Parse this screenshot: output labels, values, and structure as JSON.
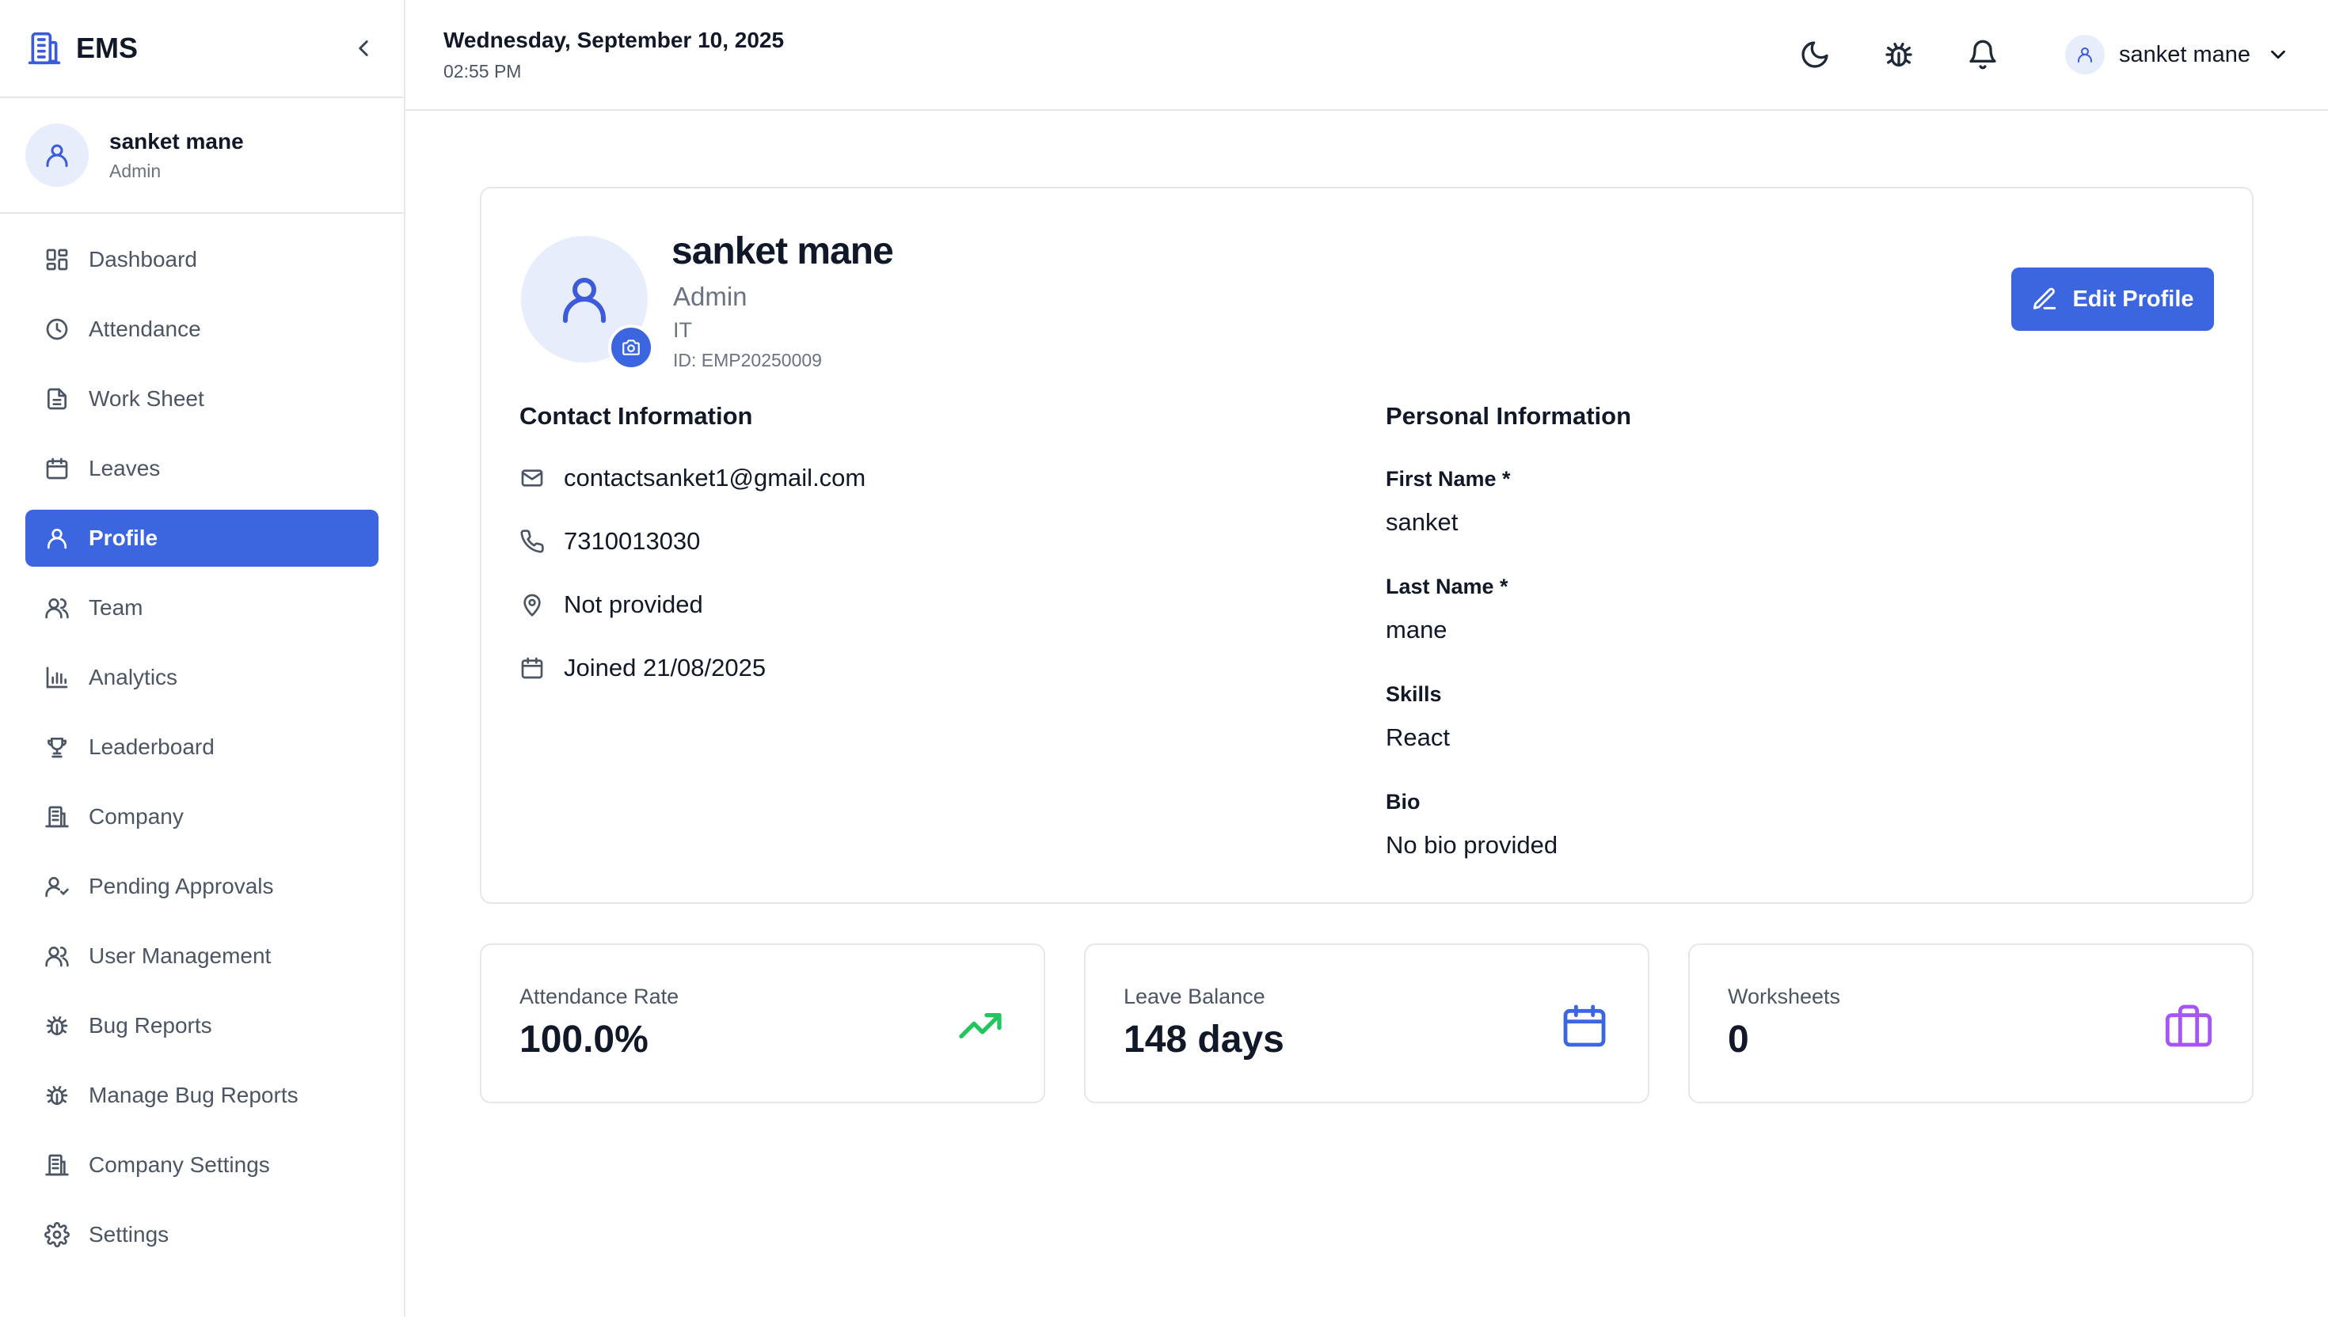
{
  "app": {
    "brand": "EMS"
  },
  "sidebar": {
    "user": {
      "name": "sanket mane",
      "role": "Admin"
    },
    "items": [
      {
        "label": "Dashboard",
        "icon": "dashboard-icon"
      },
      {
        "label": "Attendance",
        "icon": "clock-icon"
      },
      {
        "label": "Work Sheet",
        "icon": "file-icon"
      },
      {
        "label": "Leaves",
        "icon": "calendar-icon"
      },
      {
        "label": "Profile",
        "icon": "user-icon",
        "active": true
      },
      {
        "label": "Team",
        "icon": "users-icon"
      },
      {
        "label": "Analytics",
        "icon": "bar-chart-icon"
      },
      {
        "label": "Leaderboard",
        "icon": "trophy-icon"
      },
      {
        "label": "Company",
        "icon": "building-icon"
      },
      {
        "label": "Pending Approvals",
        "icon": "user-check-icon"
      },
      {
        "label": "User Management",
        "icon": "users-icon"
      },
      {
        "label": "Bug Reports",
        "icon": "bug-icon"
      },
      {
        "label": "Manage Bug Reports",
        "icon": "bug-icon"
      },
      {
        "label": "Company Settings",
        "icon": "building-icon"
      },
      {
        "label": "Settings",
        "icon": "gear-icon"
      }
    ]
  },
  "topbar": {
    "date": "Wednesday, September 10, 2025",
    "time": "02:55 PM",
    "user_name": "sanket mane"
  },
  "profile": {
    "name": "sanket mane",
    "role": "Admin",
    "department": "IT",
    "employee_id": "ID: EMP20250009",
    "edit_label": "Edit Profile"
  },
  "contact": {
    "title": "Contact Information",
    "email": "contactsanket1@gmail.com",
    "phone": "7310013030",
    "location": "Not provided",
    "joined": "Joined 21/08/2025"
  },
  "personal": {
    "title": "Personal Information",
    "first_name_label": "First Name *",
    "first_name": "sanket",
    "last_name_label": "Last Name *",
    "last_name": "mane",
    "skills_label": "Skills",
    "skills": "React",
    "bio_label": "Bio",
    "bio": "No bio provided"
  },
  "stats": [
    {
      "label": "Attendance Rate",
      "value": "100.0%",
      "icon": "trending-up-icon",
      "color": "#22c55e"
    },
    {
      "label": "Leave Balance",
      "value": "148 days",
      "icon": "calendar-icon",
      "color": "#3b66e0"
    },
    {
      "label": "Worksheets",
      "value": "0",
      "icon": "briefcase-icon",
      "color": "#a855f7"
    }
  ],
  "colors": {
    "accent": "#3b66e0",
    "border": "#e5e7eb",
    "muted": "#6b7280"
  }
}
